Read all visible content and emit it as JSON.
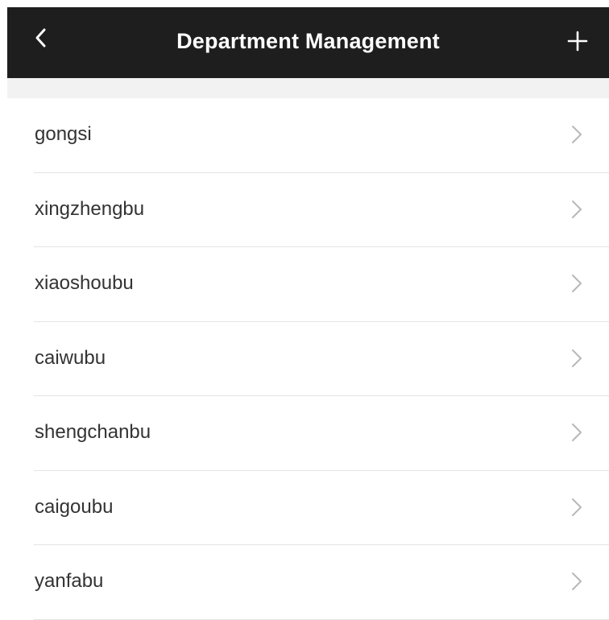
{
  "header": {
    "title": "Department Management",
    "back_icon": "chevron-left-icon",
    "add_icon": "plus-icon",
    "background": "#1e1e1e",
    "text_color": "#ffffff"
  },
  "departments": [
    {
      "label": "gongsi"
    },
    {
      "label": "xingzhengbu"
    },
    {
      "label": "xiaoshoubu"
    },
    {
      "label": "caiwubu"
    },
    {
      "label": "shengchanbu"
    },
    {
      "label": "caigoubu"
    },
    {
      "label": "yanfabu"
    }
  ],
  "row_icon": "chevron-right-icon"
}
